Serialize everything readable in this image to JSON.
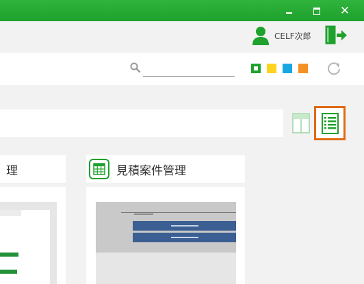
{
  "window": {
    "close_glyph": "✕"
  },
  "user": {
    "name": "CELF次郎",
    "icon": "user-icon",
    "logout_icon": "logout-icon"
  },
  "toolbar": {
    "search": {
      "value": "",
      "placeholder": ""
    },
    "color_filters": [
      "#1fa12d",
      "#ffd21e",
      "#17a8e3",
      "#f39223"
    ],
    "refresh_icon": "refresh-icon"
  },
  "view": {
    "modes": [
      "tile",
      "list"
    ],
    "selected": "list",
    "highlight_color": "#e06a14"
  },
  "cards": [
    {
      "title": "理"
    },
    {
      "title": "見積案件管理",
      "icon": "table-icon"
    }
  ],
  "colors": {
    "brand": "#1fa12d",
    "titlebar": "#2fb43c"
  }
}
